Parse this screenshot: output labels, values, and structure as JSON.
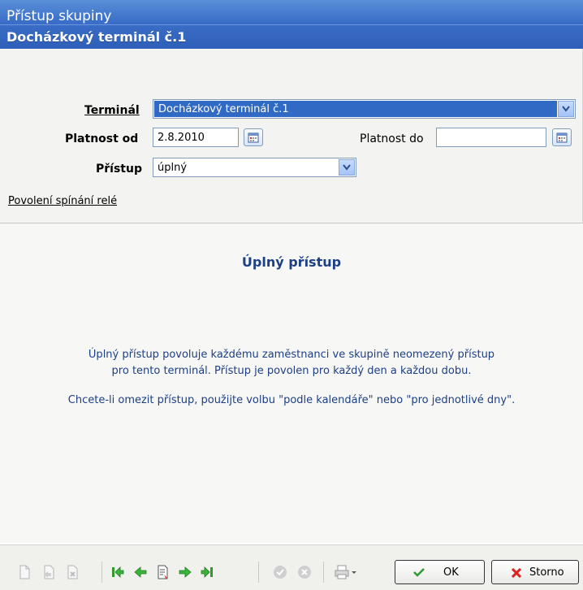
{
  "window": {
    "title": "Přístup skupiny",
    "subtitle": "Docházkový terminál č.1"
  },
  "form": {
    "terminal_label": "Terminál",
    "terminal_value": "Docházkový terminál č.1",
    "valid_from_label": "Platnost od",
    "valid_from_value": "2.8.2010",
    "valid_to_label": "Platnost do",
    "valid_to_value": "",
    "access_label": "Přístup",
    "access_value": "úplný",
    "relay_link": "Povolení spínání relé"
  },
  "content": {
    "heading": "Úplný přístup",
    "line1": "Úplný přístup povoluje každému zaměstnanci ve skupině neomezený přístup",
    "line2": "pro tento terminál. Přístup je povolen pro každý den a každou dobu.",
    "line3": "Chcete-li omezit přístup, použijte volbu \"podle kalendáře\" nebo \"pro jednotlivé dny\"."
  },
  "buttons": {
    "ok": "OK",
    "cancel": "Storno"
  },
  "colors": {
    "title_bar": "#3b6ec8",
    "content_text": "#1d3f86",
    "selection": "#316ac5"
  }
}
